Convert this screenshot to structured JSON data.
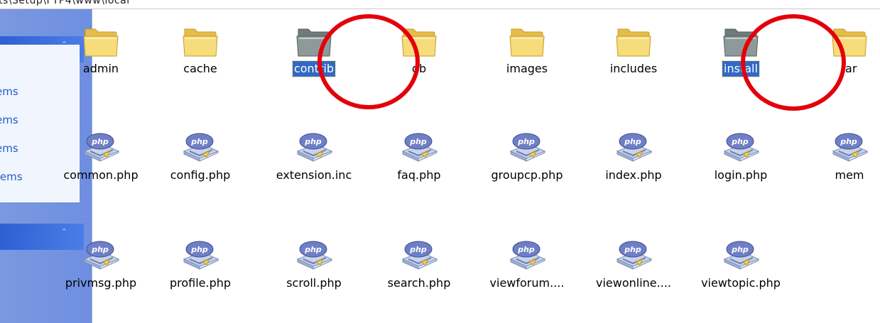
{
  "address_bar": {
    "text": "ts\\Setup\\FTP4\\www\\local"
  },
  "task_pane": {
    "items": [
      {
        "label": "ems"
      },
      {
        "label": "ems"
      },
      {
        "label": "ems"
      },
      {
        "label": "tems"
      }
    ]
  },
  "files": {
    "row1": [
      {
        "name": "admin",
        "type": "folder"
      },
      {
        "name": "cache",
        "type": "folder"
      },
      {
        "name": "contrib",
        "type": "folder-grey",
        "selected": true
      },
      {
        "name": "db",
        "type": "folder"
      },
      {
        "name": "images",
        "type": "folder"
      },
      {
        "name": "includes",
        "type": "folder"
      },
      {
        "name": "install",
        "type": "folder-grey",
        "selected": true
      },
      {
        "name": "lar",
        "type": "folder"
      }
    ],
    "row2": [
      {
        "name": "common.php"
      },
      {
        "name": "config.php"
      },
      {
        "name": "extension.inc"
      },
      {
        "name": "faq.php"
      },
      {
        "name": "groupcp.php"
      },
      {
        "name": "index.php"
      },
      {
        "name": "login.php"
      },
      {
        "name": "mem"
      }
    ],
    "row3": [
      {
        "name": "privmsg.php"
      },
      {
        "name": "profile.php"
      },
      {
        "name": "scroll.php"
      },
      {
        "name": "search.php"
      },
      {
        "name": "viewforum...."
      },
      {
        "name": "viewonline...."
      },
      {
        "name": "viewtopic.php"
      }
    ]
  },
  "colors": {
    "annotation": "#e3000b",
    "selection": "#316ac5",
    "taskpane": "#7896dc"
  }
}
